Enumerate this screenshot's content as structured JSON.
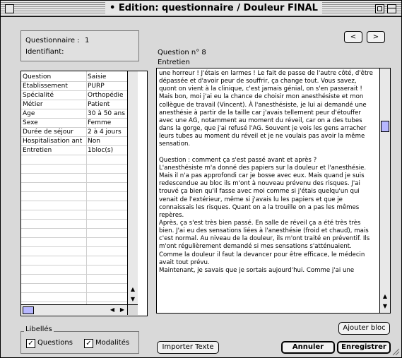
{
  "window": {
    "title": "• Edition: questionnaire / Douleur FINAL"
  },
  "info": {
    "questionnaire_label": "Questionnaire :",
    "questionnaire_value": "1",
    "identifiant_label": "Identifiant:"
  },
  "question": {
    "number_label": "Question n° 8",
    "name": "Entretien",
    "prev": "<",
    "next": ">"
  },
  "table": {
    "headers": [
      "Question",
      "Saisie"
    ],
    "rows": [
      [
        "Etablissement",
        "PURP"
      ],
      [
        "Spécialité",
        "Orthopédie"
      ],
      [
        "Métier",
        "Patient"
      ],
      [
        "Age",
        "30 à 50 ans"
      ],
      [
        "Sexe",
        "Femme"
      ],
      [
        "Durée de séjour",
        "2 à 4 jours"
      ],
      [
        "Hospitalisation ant",
        "Non"
      ],
      [
        "Entretien",
        "1bloc(s)"
      ]
    ]
  },
  "answer_text": "une horreur ! J'étais en larmes ! Le fait de passe de l'autre côté, d'être dépassée et d'avoir peur de souffrir, ça change tout. Vous savez, quont on vient à la clinique, c'est jamais génial, on s'en passerait !\nMais bon, moi j'ai eu la chance de choisir mon anesthésiste et mon collègue de travail (Vincent). À l'anesthésiste, je lui ai demandé une anesthésie à partir de la taille car j'avais tellement peur d'étouffer avec une AG, notamment au moment du réveil, car on a des tubes dans la gorge, que j'ai refusé l'AG. Souvent je vois les gens arracher leurs tubes au moment du réveil et je ne voulais pas avoir la même sensation.\n\nQuestion : comment ça s'est passé avant et après ?\nL'anesthésiste m'a donné des papiers sur la douleur et l'anesthésie. Mais il n'a pas approfondi car je bosse avec eux. Mais quand je suis redescendue au bloc ils m'ont à nouveau prévenu des risques. J'ai trouvé ça bien qu'il fasse avec moi comme si j'étais quelqu'un qui venait de l'extérieur, même si j'avais lu les papiers et que je connaissais les risques. Quant on a la trouille on a pas les mêmes repères.\nAprès, ça s'est très bien passé. En salle de réveil ça a été très très bien. J'ai eu des sensations liées à l'anesthésie (froid et chaud), mais c'est normal. Au niveau de la douleur, ils m'ont traité en préventif. Ils m'ont régulièrement demandé si mes sensations s'atténuaient. Comme la douleur il faut la devancer pour être efficace, le médecin avait tout prévu.\nMaintenant, je savais que je sortais aujourd'hui. Comme j'ai une",
  "libelles": {
    "group_label": "Libellés",
    "questions_label": "Questions",
    "modalites_label": "Modalités",
    "check_glyph": "✓"
  },
  "buttons": {
    "ajouter": "Ajouter bloc",
    "importer": "Importer Texte",
    "annuler": "Annuler",
    "enregistrer": "Enregistrer"
  },
  "scroll_glyphs": {
    "up": "▲",
    "down": "▼",
    "left": "◀",
    "right": "▶"
  }
}
